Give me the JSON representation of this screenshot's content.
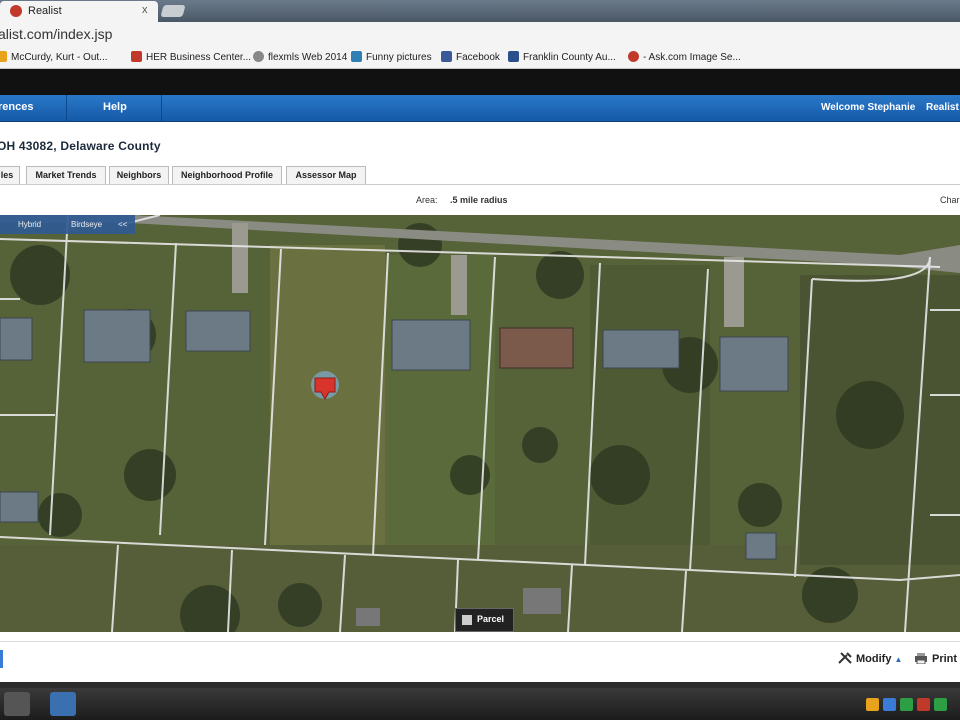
{
  "browser": {
    "tab_title": "Realist",
    "tab_close": "x",
    "url": "alist.com/index.jsp",
    "bookmarks": [
      {
        "label": "McCurdy, Kurt - Out...",
        "icon": "outlook-icon",
        "color": "#e8a21b"
      },
      {
        "label": "HER Business Center...",
        "icon": "her-icon",
        "color": "#c0392b"
      },
      {
        "label": "flexmls Web 2014",
        "icon": "flexmls-icon",
        "color": "#888"
      },
      {
        "label": "Funny pictures",
        "icon": "pictures-icon",
        "color": "#2f7fb5"
      },
      {
        "label": "Facebook",
        "icon": "facebook-icon",
        "color": "#3b5998"
      },
      {
        "label": "Franklin County Au...",
        "icon": "franklin-icon",
        "color": "#2b4f8c"
      },
      {
        "label": "- Ask.com Image Se...",
        "icon": "ask-icon",
        "color": "#c0392b"
      }
    ]
  },
  "app": {
    "nav_left": "rences",
    "nav_help": "Help",
    "welcome": "Welcome Stephanie",
    "nav_right": "Realist",
    "location": "OH 43082, Delaware County",
    "tabs": [
      "les",
      "Market Trends",
      "Neighbors",
      "Neighborhood Profile",
      "Assessor Map"
    ],
    "area_label": "Area:",
    "area_value": ".5 mile radius",
    "chart_label": "Char"
  },
  "map": {
    "toolbar": {
      "hybrid": "Hybrid",
      "birdseye": "Birdseye",
      "collapse": "<<"
    },
    "parcel_button": "Parcel"
  },
  "footer": {
    "modify": "Modify",
    "print": "Print"
  }
}
